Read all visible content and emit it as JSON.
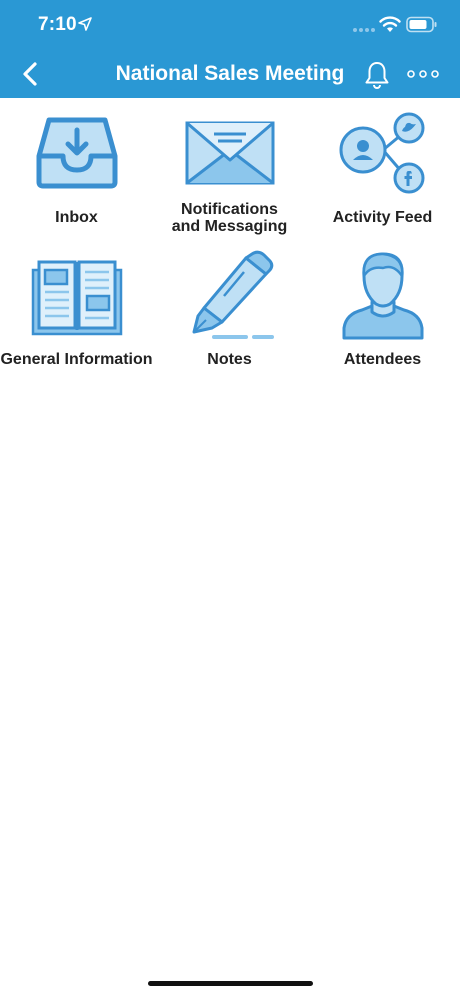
{
  "status_bar": {
    "time": "7:10",
    "icons": [
      "location-arrow-icon",
      "signal-dots-icon",
      "wifi-icon",
      "battery-icon"
    ]
  },
  "nav": {
    "title": "National Sales Meeting",
    "back_icon": "chevron-left-icon",
    "bell_icon": "bell-icon",
    "more_icon": "more-horizontal-icon"
  },
  "tiles": [
    {
      "label": "Inbox",
      "icon": "inbox-icon"
    },
    {
      "label_line1": "Notifications",
      "label_line2": "and Messaging",
      "icon": "envelope-icon"
    },
    {
      "label": "Activity Feed",
      "icon": "social-share-icon"
    },
    {
      "label": "General Information",
      "icon": "open-book-icon"
    },
    {
      "label": "Notes",
      "icon": "pen-icon"
    },
    {
      "label": "Attendees",
      "icon": "person-icon"
    }
  ],
  "colors": {
    "brand": "#2a98d4",
    "icon_stroke": "#3a8fd0",
    "icon_fill_light": "#bfe0f5",
    "icon_fill_mid": "#8cc6ec",
    "text": "#222222"
  }
}
